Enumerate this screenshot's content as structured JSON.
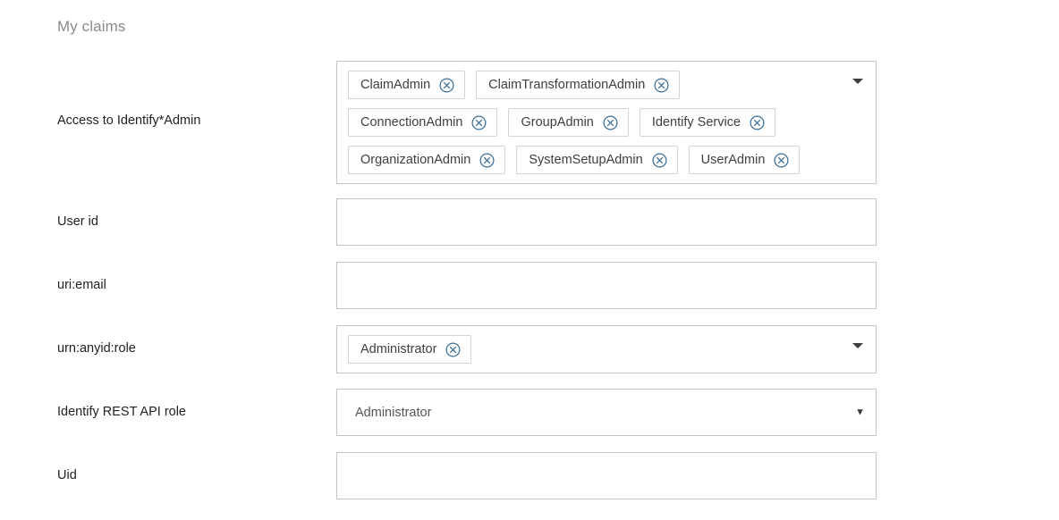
{
  "section": {
    "title": "My claims"
  },
  "colors": {
    "chip_icon": "#3a6f9a",
    "field_border": "#c4c4c4",
    "chip_border": "#d3d3d3",
    "label_text": "#222222",
    "title_text": "#8a8a8a",
    "caret": "#3c3c3c"
  },
  "rows": [
    {
      "label": "Access to Identify*Admin",
      "type": "multiselect",
      "chips": [
        "ClaimAdmin",
        "ClaimTransformationAdmin",
        "ConnectionAdmin",
        "GroupAdmin",
        "Identify Service",
        "OrganizationAdmin",
        "SystemSetupAdmin",
        "UserAdmin"
      ],
      "remove_icon": "close-circle-icon",
      "caret_icon": "chevron-down-icon"
    },
    {
      "label": "User id",
      "type": "text",
      "value": "",
      "placeholder": ""
    },
    {
      "label": "uri:email",
      "type": "text",
      "value": "",
      "placeholder": ""
    },
    {
      "label": "urn:anyid:role",
      "type": "multiselect",
      "chips": [
        "Administrator"
      ],
      "remove_icon": "close-circle-icon",
      "caret_icon": "chevron-down-icon"
    },
    {
      "label": "Identify REST API role",
      "type": "select",
      "value": "Administrator",
      "caret_glyph": "▼",
      "caret_icon": "chevron-down-icon"
    },
    {
      "label": "Uid",
      "type": "text",
      "value": "",
      "placeholder": ""
    }
  ]
}
